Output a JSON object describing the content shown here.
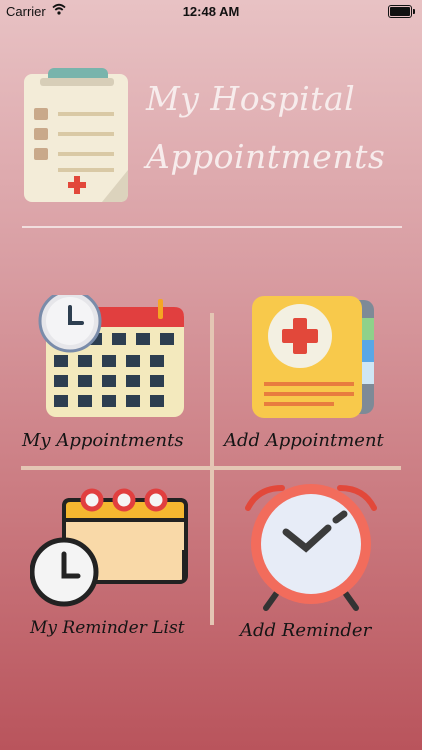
{
  "status_bar": {
    "carrier": "Carrier",
    "time": "12:48 AM"
  },
  "header": {
    "title_line1": "My Hospital",
    "title_line2": "Appointments"
  },
  "menu": {
    "my_appointments": "My Appointments",
    "add_appointment": "Add Appointment",
    "my_reminder_list": "My Reminder List",
    "add_reminder": "Add Reminder"
  },
  "colors": {
    "background_top": "#e8c2c4",
    "background_bottom": "#b9545c",
    "title_text": "#f7ecec",
    "divider": "#e4c6b4"
  },
  "icons": [
    "clipboard-icon",
    "calendar-clock-icon",
    "medical-folder-icon",
    "calendar-reminder-icon",
    "alarm-clock-icon",
    "wifi-icon",
    "battery-icon"
  ]
}
